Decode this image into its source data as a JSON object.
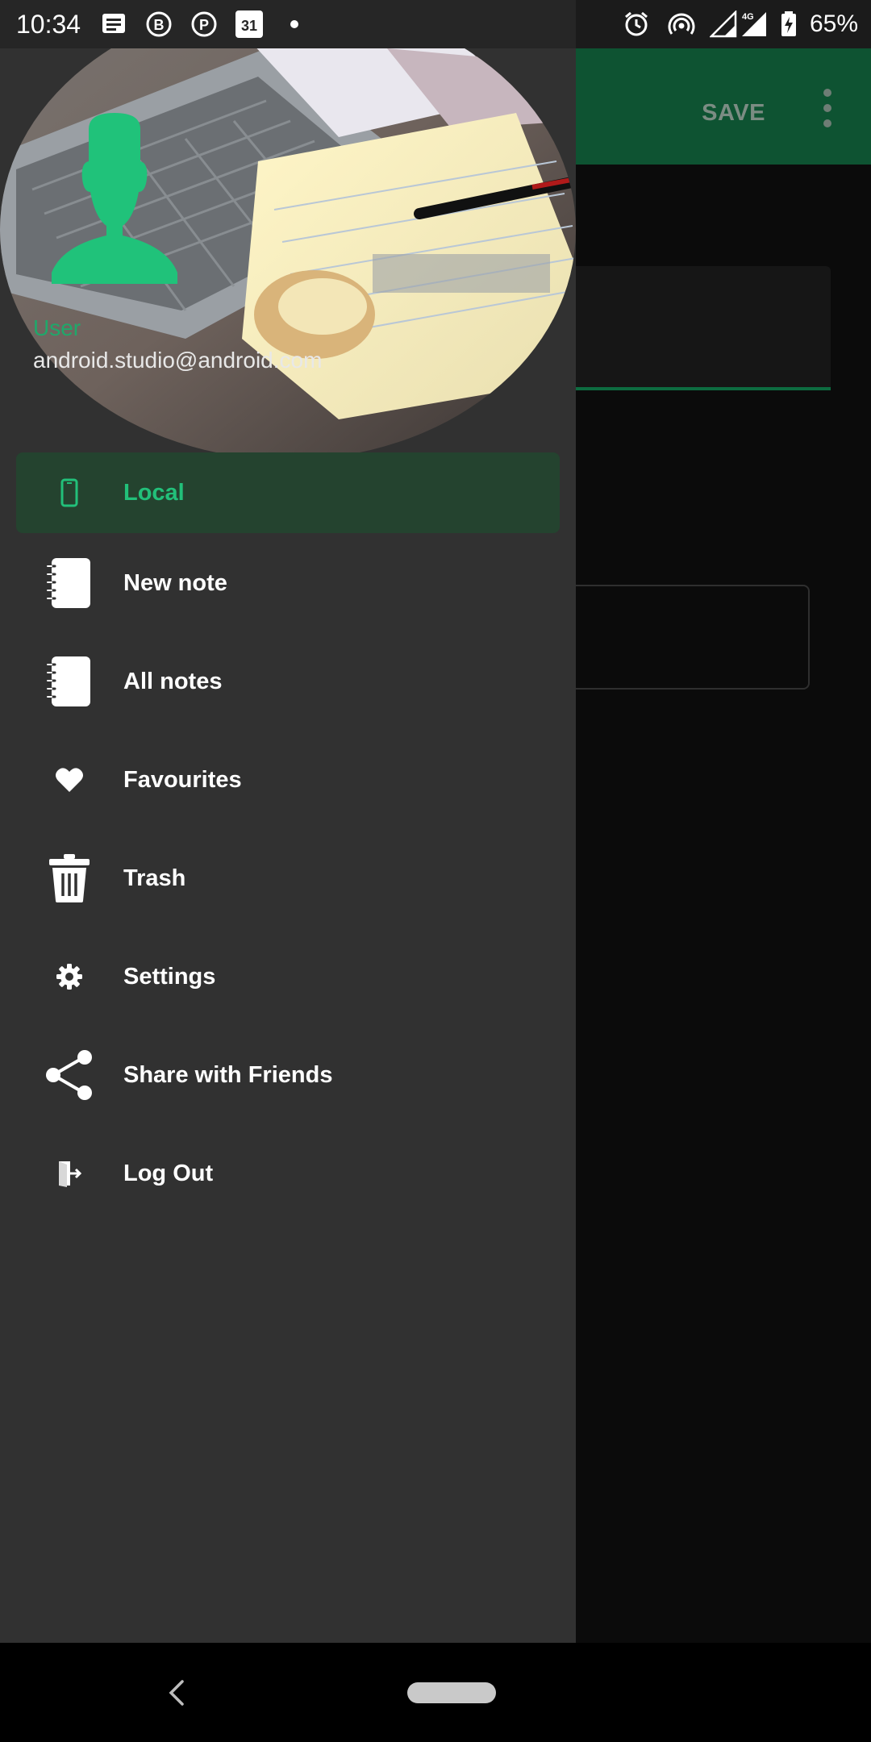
{
  "status_bar": {
    "time": "10:34",
    "battery": "65%",
    "network": "4G",
    "calendar_day": "31",
    "left_icons": [
      "messages-icon",
      "b-icon",
      "pinterest-icon",
      "calendar-icon",
      "dot-icon"
    ],
    "right_icons": [
      "alarm-icon",
      "hotspot-icon",
      "signal-icon",
      "signal-4g-icon",
      "battery-icon"
    ]
  },
  "toolbar": {
    "save_label": "SAVE",
    "accent_color": "#0e5332"
  },
  "drawer": {
    "user_name": "User",
    "user_email": "android.studio@android.com",
    "accent_color": "#22c07a",
    "items": [
      {
        "label": "Local",
        "icon": "phone-icon",
        "selected": true
      },
      {
        "label": "New note",
        "icon": "notebook-icon",
        "selected": false
      },
      {
        "label": "All notes",
        "icon": "notebook-icon",
        "selected": false
      },
      {
        "label": "Favourites",
        "icon": "heart-icon",
        "selected": false
      },
      {
        "label": "Trash",
        "icon": "trash-icon",
        "selected": false
      },
      {
        "label": "Settings",
        "icon": "gear-icon",
        "selected": false
      },
      {
        "label": "Share with Friends",
        "icon": "share-icon",
        "selected": false
      },
      {
        "label": "Log Out",
        "icon": "logout-icon",
        "selected": false
      }
    ]
  },
  "nav_bar": {
    "buttons": [
      "back-icon",
      "home-pill"
    ]
  }
}
